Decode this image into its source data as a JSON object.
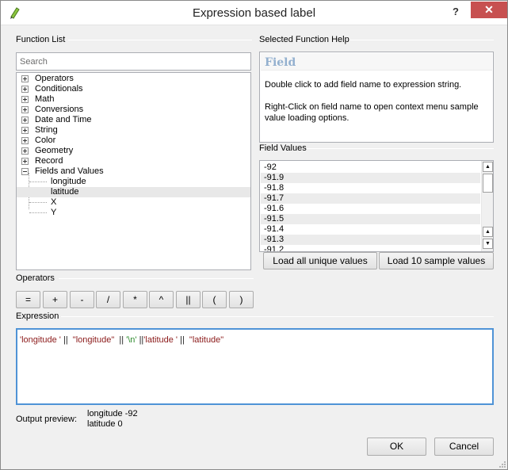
{
  "window": {
    "title": "Expression based label",
    "help_glyph": "?",
    "close_glyph": "✕"
  },
  "function_list": {
    "group_label": "Function List",
    "search_placeholder": "Search",
    "categories": [
      "Operators",
      "Conditionals",
      "Math",
      "Conversions",
      "Date and Time",
      "String",
      "Color",
      "Geometry",
      "Record",
      "Fields and Values"
    ],
    "field_children": [
      "longitude",
      "latitude",
      "X",
      "Y"
    ],
    "selected_child": "latitude"
  },
  "help": {
    "group_label": "Selected Function Help",
    "title": "Field",
    "text1": "Double click to add field name to expression string.",
    "text2": "Right-Click on field name to open context menu sample value loading options."
  },
  "field_values": {
    "group_label": "Field Values",
    "values": [
      "-92",
      "-91.9",
      "-91.8",
      "-91.7",
      "-91.6",
      "-91.5",
      "-91.4",
      "-91.3",
      "-91.2"
    ],
    "load_all_label": "Load all unique values",
    "load_sample_label": "Load 10 sample values"
  },
  "operators": {
    "group_label": "Operators",
    "buttons": [
      "=",
      "+",
      "-",
      "/",
      "*",
      "^",
      "||",
      "(",
      ")"
    ]
  },
  "expression": {
    "group_label": "Expression",
    "tokens": [
      {
        "text": "'longitude '",
        "kind": "red"
      },
      {
        "text": " || ",
        "kind": "op"
      },
      {
        "text": " \"longitude\" ",
        "kind": "red"
      },
      {
        "text": " || ",
        "kind": "op"
      },
      {
        "text": "'\\n'",
        "kind": "str"
      },
      {
        "text": " ||",
        "kind": "op"
      },
      {
        "text": "'latitude '",
        "kind": "red"
      },
      {
        "text": " || ",
        "kind": "op"
      },
      {
        "text": " \"latitude\"",
        "kind": "red"
      }
    ]
  },
  "output_preview": {
    "label": "Output preview:",
    "line1": "longitude -92",
    "line2": "latitude 0"
  },
  "dialog_buttons": {
    "ok": "OK",
    "cancel": "Cancel"
  },
  "colors": {
    "close_button": "#c75050",
    "focus_border": "#4f93d6",
    "help_title": "#93b0cf",
    "string_literal": "#2e8b2e",
    "field_token": "#8b1a1a"
  }
}
